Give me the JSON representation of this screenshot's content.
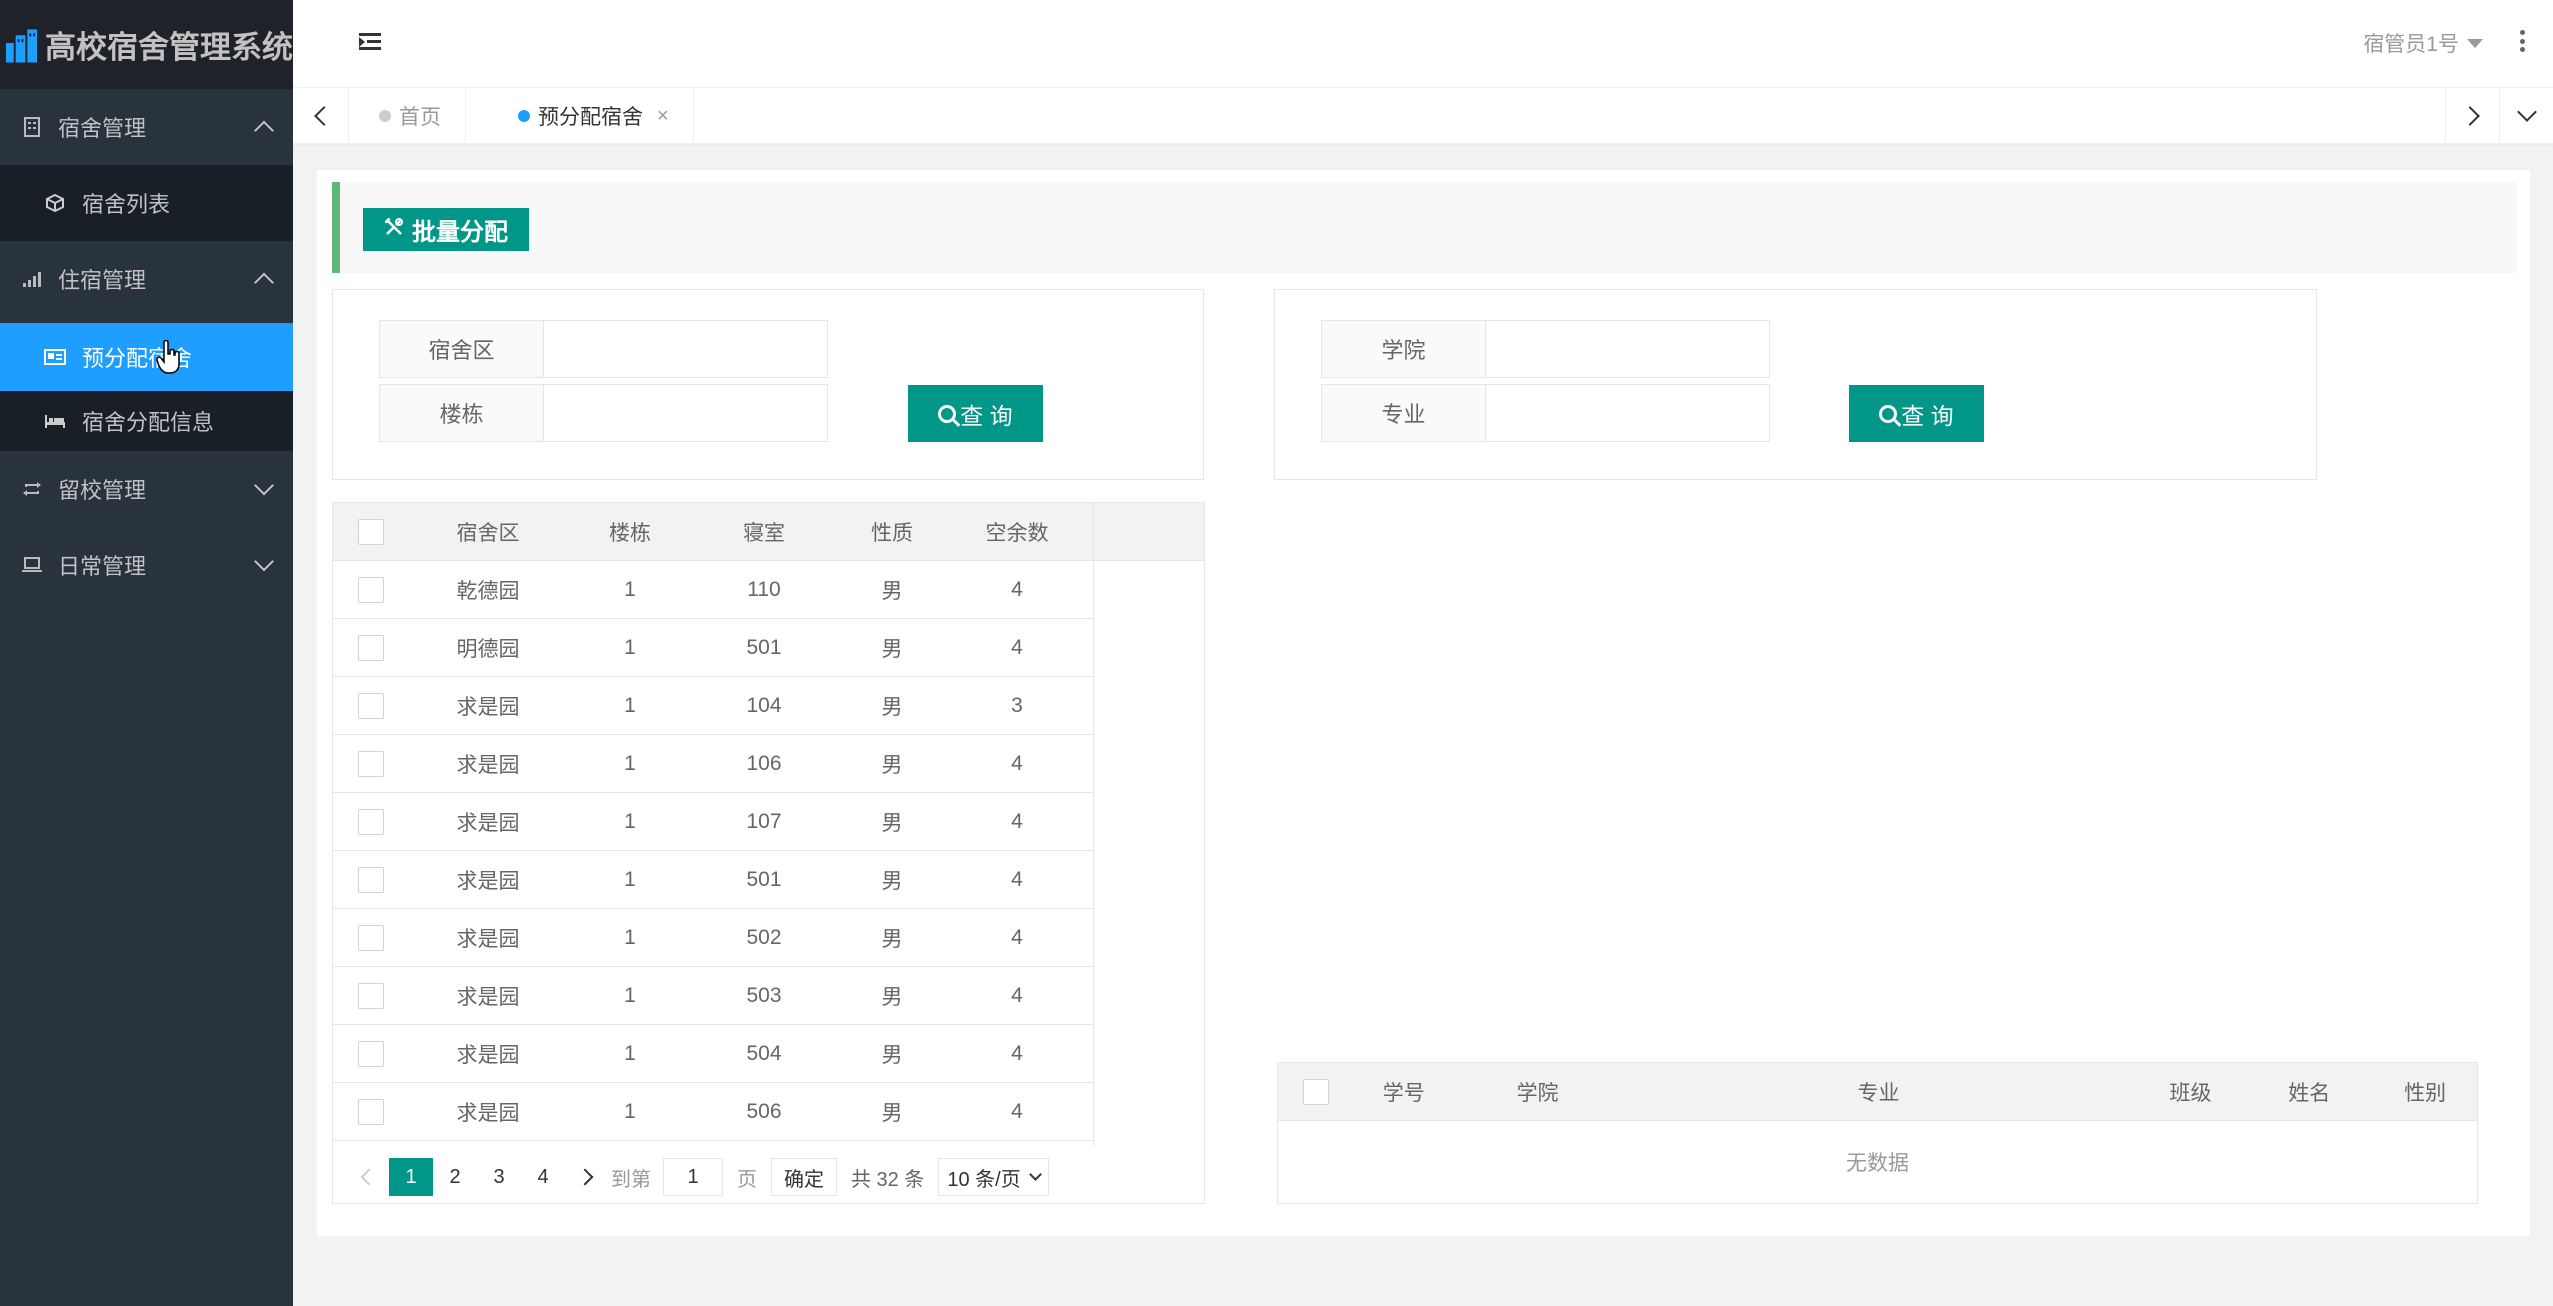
{
  "app": {
    "title": "高校宿舍管理系统"
  },
  "sidebar": {
    "groups": [
      {
        "label": "宿舍管理",
        "expanded": true,
        "items": [
          {
            "label": "宿舍列表"
          }
        ]
      },
      {
        "label": "住宿管理",
        "expanded": true,
        "items": [
          {
            "label": "预分配宿舍",
            "active": true
          },
          {
            "label": "宿舍分配信息"
          }
        ]
      },
      {
        "label": "留校管理",
        "expanded": false,
        "items": []
      },
      {
        "label": "日常管理",
        "expanded": false,
        "items": []
      }
    ]
  },
  "header": {
    "user": "宿管员1号"
  },
  "tabs": [
    {
      "label": "首页",
      "active": false
    },
    {
      "label": "预分配宿舍",
      "active": true,
      "close": "×"
    }
  ],
  "toolbar": {
    "batch_label": "批量分配"
  },
  "dorm_search": {
    "area_label": "宿舍区",
    "area_value": "",
    "building_label": "楼栋",
    "building_value": "",
    "query_label": "查 询"
  },
  "student_search": {
    "college_label": "学院",
    "college_value": "",
    "major_label": "专业",
    "major_value": "",
    "query_label": "查 询"
  },
  "dorm_table": {
    "columns": [
      "宿舍区",
      "楼栋",
      "寝室",
      "性质",
      "空余数"
    ],
    "rows": [
      [
        "乾德园",
        "1",
        "110",
        "男",
        "4"
      ],
      [
        "明德园",
        "1",
        "501",
        "男",
        "4"
      ],
      [
        "求是园",
        "1",
        "104",
        "男",
        "3"
      ],
      [
        "求是园",
        "1",
        "106",
        "男",
        "4"
      ],
      [
        "求是园",
        "1",
        "107",
        "男",
        "4"
      ],
      [
        "求是园",
        "1",
        "501",
        "男",
        "4"
      ],
      [
        "求是园",
        "1",
        "502",
        "男",
        "4"
      ],
      [
        "求是园",
        "1",
        "503",
        "男",
        "4"
      ],
      [
        "求是园",
        "1",
        "504",
        "男",
        "4"
      ],
      [
        "求是园",
        "1",
        "506",
        "男",
        "4"
      ]
    ]
  },
  "pagination": {
    "pages": [
      "1",
      "2",
      "3",
      "4"
    ],
    "current": "1",
    "goto_label": "到第",
    "goto_value": "1",
    "page_unit": "页",
    "confirm_label": "确定",
    "total_label": "共 32 条",
    "page_size": "10 条/页"
  },
  "student_table": {
    "columns": [
      "学号",
      "学院",
      "专业",
      "班级",
      "姓名",
      "性别"
    ],
    "empty_text": "无数据"
  },
  "colors": {
    "sidebar_bg": "#28333e",
    "active_blue": "#1e9fff",
    "primary_green": "#009688",
    "accent_green": "#5fb878"
  }
}
